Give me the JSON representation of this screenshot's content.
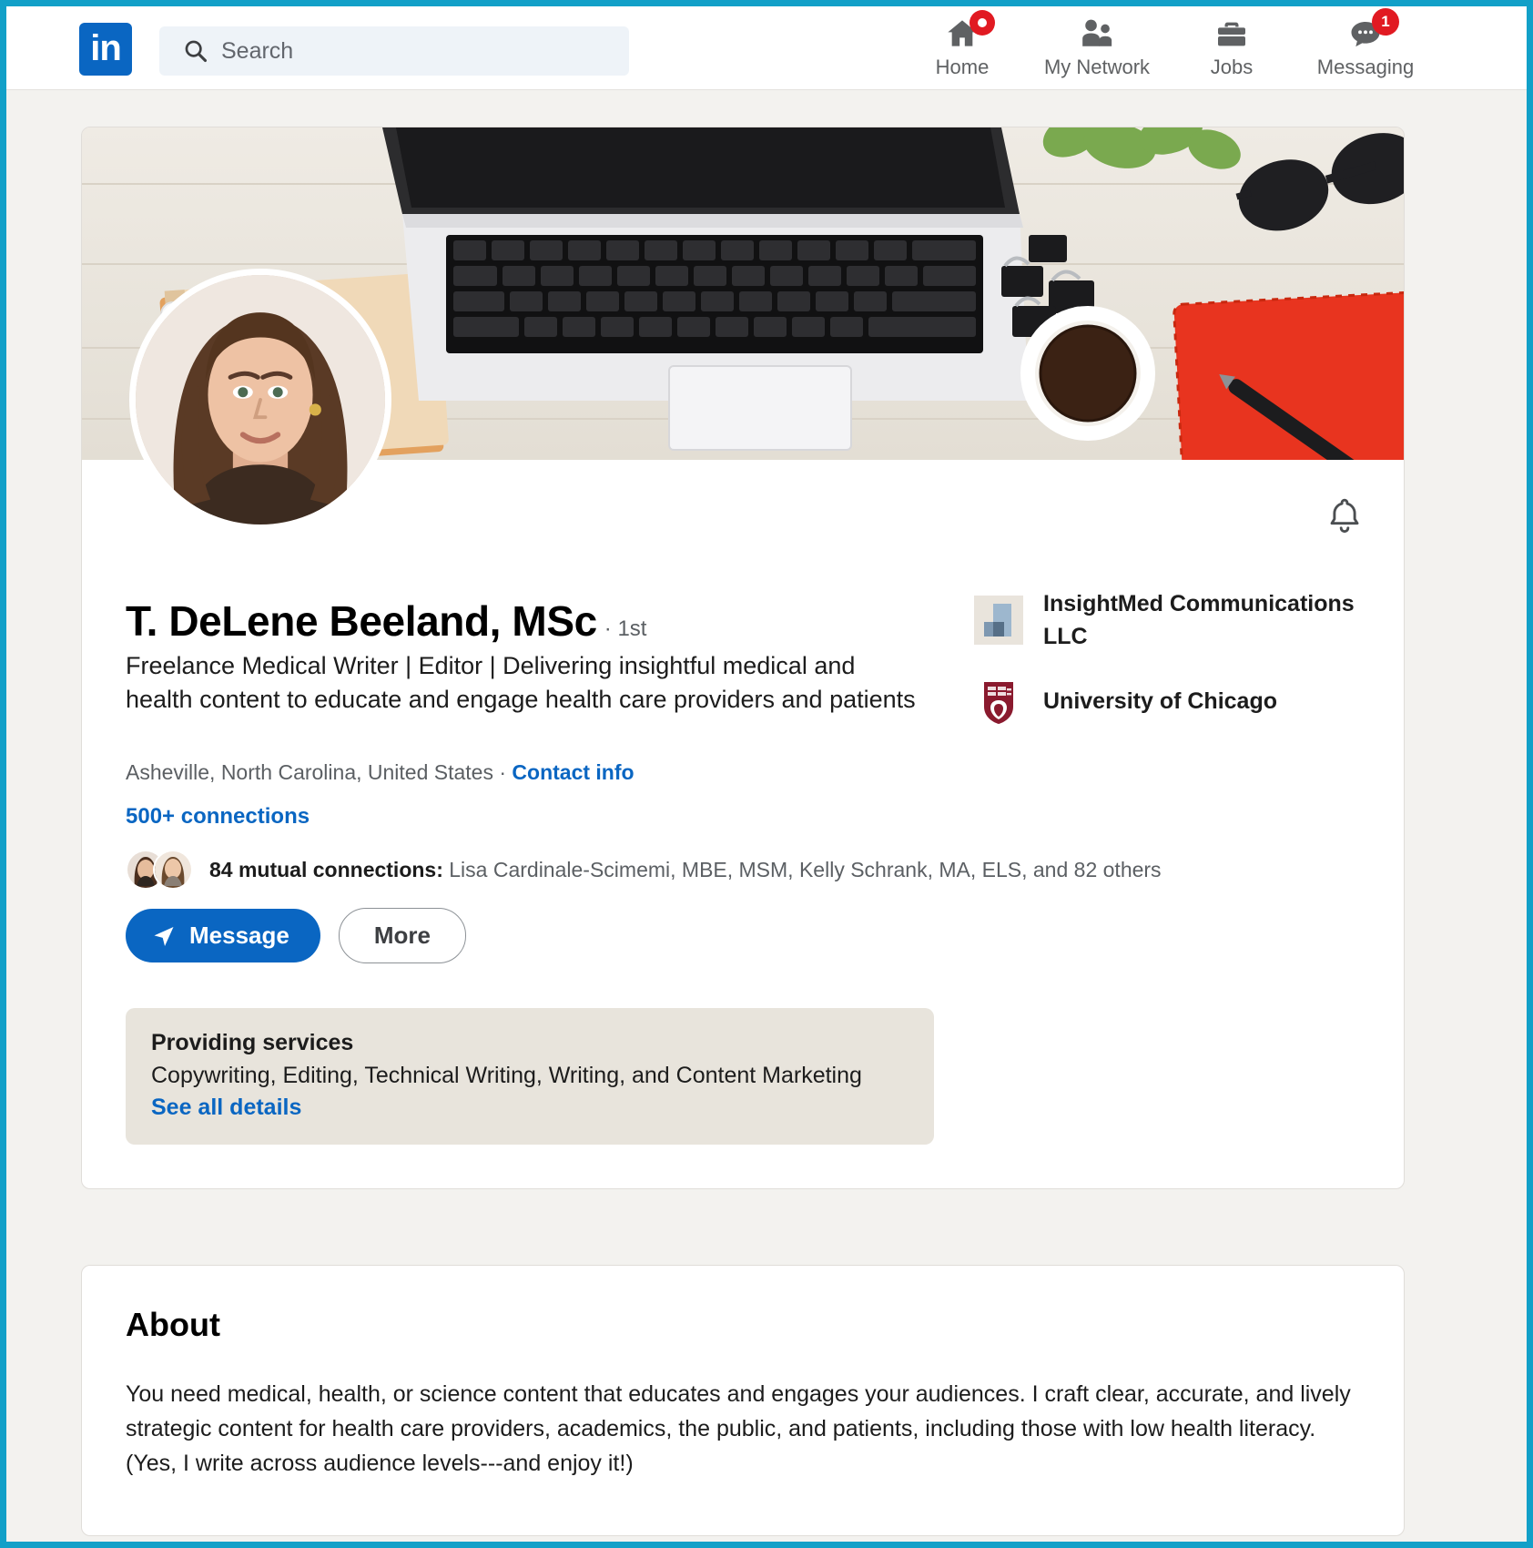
{
  "nav": {
    "logo_text": "in",
    "search_placeholder": "Search",
    "items": [
      {
        "label": "Home",
        "icon": "home-icon",
        "badge": ""
      },
      {
        "label": "My Network",
        "icon": "people-icon",
        "badge": ""
      },
      {
        "label": "Jobs",
        "icon": "briefcase-icon",
        "badge": ""
      },
      {
        "label": "Messaging",
        "icon": "message-bubble-icon",
        "badge": "1"
      }
    ]
  },
  "profile": {
    "name": "T. DeLene Beeland, MSc",
    "degree": "· 1st",
    "headline": "Freelance Medical Writer | Editor | Delivering insightful medical and health content to educate and engage health care providers and patients",
    "location": "Asheville, North Carolina, United States · ",
    "contact_info": "Contact info",
    "connections": "500+ connections",
    "mutual_count": "84 mutual connections:",
    "mutual_names": " Lisa Cardinale-Scimemi, MBE, MSM, Kelly Schrank, MA, ELS, and 82 others",
    "message_button": "Message",
    "more_button": "More"
  },
  "services": {
    "title": "Providing services",
    "list": "Copywriting, Editing, Technical Writing, Writing, and Content Marketing",
    "link": "See all details"
  },
  "organizations": [
    {
      "name": "InsightMed Communications LLC",
      "logo": "insightmed-logo"
    },
    {
      "name": "University of Chicago",
      "logo": "uchicago-shield-logo"
    }
  ],
  "about": {
    "title": "About",
    "text": "You need medical, health, or science content that educates and engages your audiences. I craft clear, accurate, and lively strategic content for health care providers, academics, the public, and patients, including those with low health literacy. (Yes, I write across audience levels---and enjoy it!)"
  },
  "colors": {
    "linkedin_blue": "#0a66c2",
    "frame_teal": "#12a0c8",
    "badge_red": "#e11a22",
    "services_bg": "#e8e4dc",
    "page_bg": "#f3f2ef"
  }
}
